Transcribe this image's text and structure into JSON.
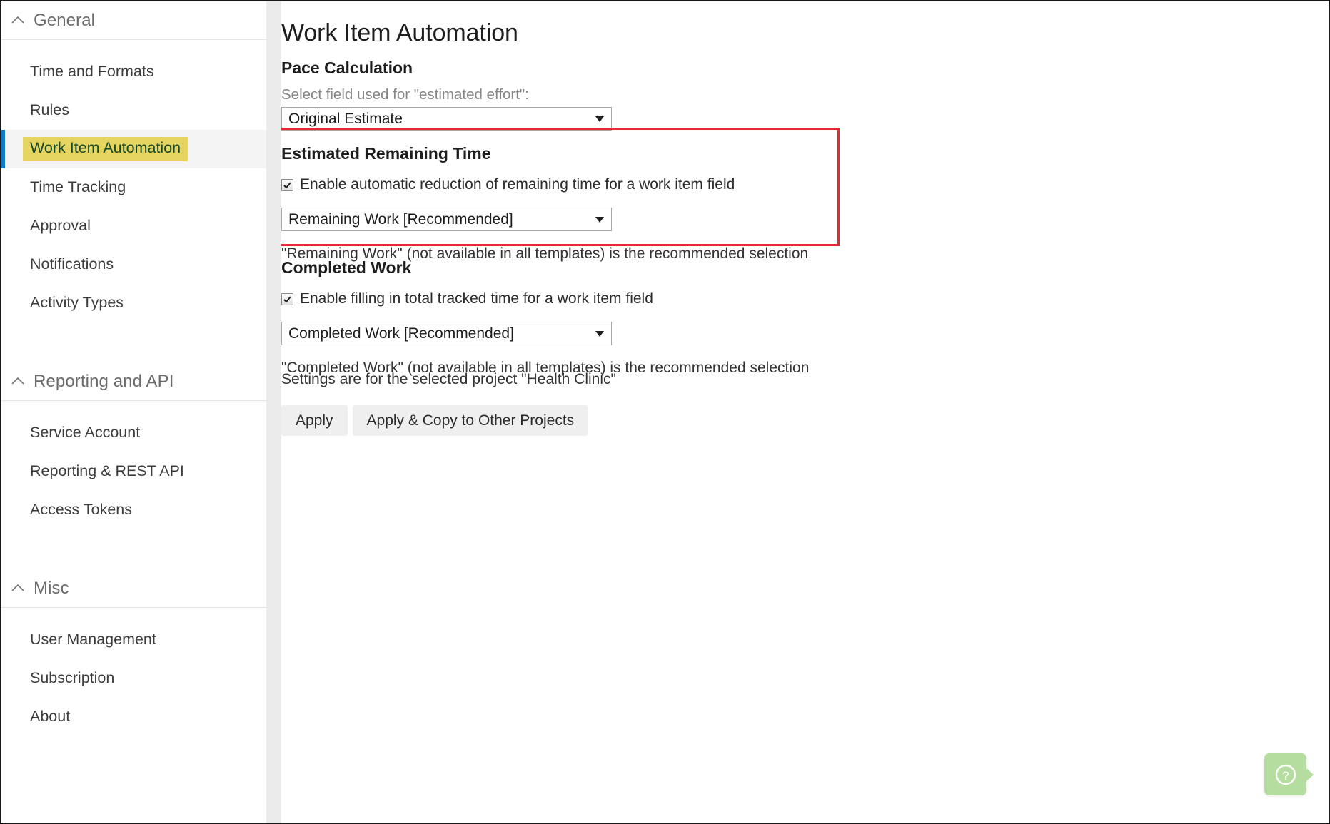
{
  "sidebar": {
    "sections": [
      {
        "id": "general",
        "label": "General",
        "chevron_icon": "chevron-up-icon",
        "items": [
          {
            "label": "Time and Formats",
            "selected": false
          },
          {
            "label": "Rules",
            "selected": false
          },
          {
            "label": "Work Item Automation",
            "selected": true
          },
          {
            "label": "Time Tracking",
            "selected": false
          },
          {
            "label": "Approval",
            "selected": false
          },
          {
            "label": "Notifications",
            "selected": false
          },
          {
            "label": "Activity Types",
            "selected": false
          }
        ]
      },
      {
        "id": "reporting-and-api",
        "label": "Reporting and API",
        "chevron_icon": "chevron-up-icon",
        "items": [
          {
            "label": "Service Account",
            "selected": false
          },
          {
            "label": "Reporting & REST API",
            "selected": false
          },
          {
            "label": "Access Tokens",
            "selected": false
          }
        ]
      },
      {
        "id": "misc",
        "label": "Misc",
        "chevron_icon": "chevron-up-icon",
        "items": [
          {
            "label": "User Management",
            "selected": false
          },
          {
            "label": "Subscription",
            "selected": false
          },
          {
            "label": "About",
            "selected": false
          }
        ]
      }
    ]
  },
  "main": {
    "title": "Work Item Automation",
    "pace_calculation": {
      "heading": "Pace Calculation",
      "field_label": "Select field used for \"estimated effort\":",
      "dropdown_value": "Original Estimate",
      "dropdown_arrow_icon": "chevron-down-icon"
    },
    "estimated_remaining_time": {
      "heading": "Estimated Remaining Time",
      "checkbox_label": "Enable automatic reduction of remaining time for a work item field",
      "checkbox_checked": true,
      "checkbox_icon": "checkmark-icon",
      "dropdown_value": "Remaining Work [Recommended]",
      "dropdown_arrow_icon": "chevron-down-icon",
      "note": "\"Remaining Work\" (not available in all templates) is the recommended selection",
      "highlight_color": "#ec2433"
    },
    "completed_work": {
      "heading": "Completed Work",
      "checkbox_label": "Enable filling in total tracked time for a work item field",
      "checkbox_checked": true,
      "checkbox_icon": "checkmark-icon",
      "dropdown_value": "Completed Work [Recommended]",
      "dropdown_arrow_icon": "chevron-down-icon",
      "note": "\"Completed Work\" (not available in all templates) is the recommended selection"
    },
    "footer": {
      "project_note": "Settings are for the selected project \"Health Clinic\"",
      "apply_button": "Apply",
      "apply_copy_button": "Apply & Copy to Other Projects"
    }
  },
  "help": {
    "icon": "question-mark-icon",
    "color": "#b6dda0"
  },
  "colors": {
    "selection_highlight": "#e5d45f",
    "selection_text": "#14492e",
    "accent_bar": "#0f79c8",
    "callout_border": "#ec2433",
    "help_bg": "#b6dda0"
  }
}
